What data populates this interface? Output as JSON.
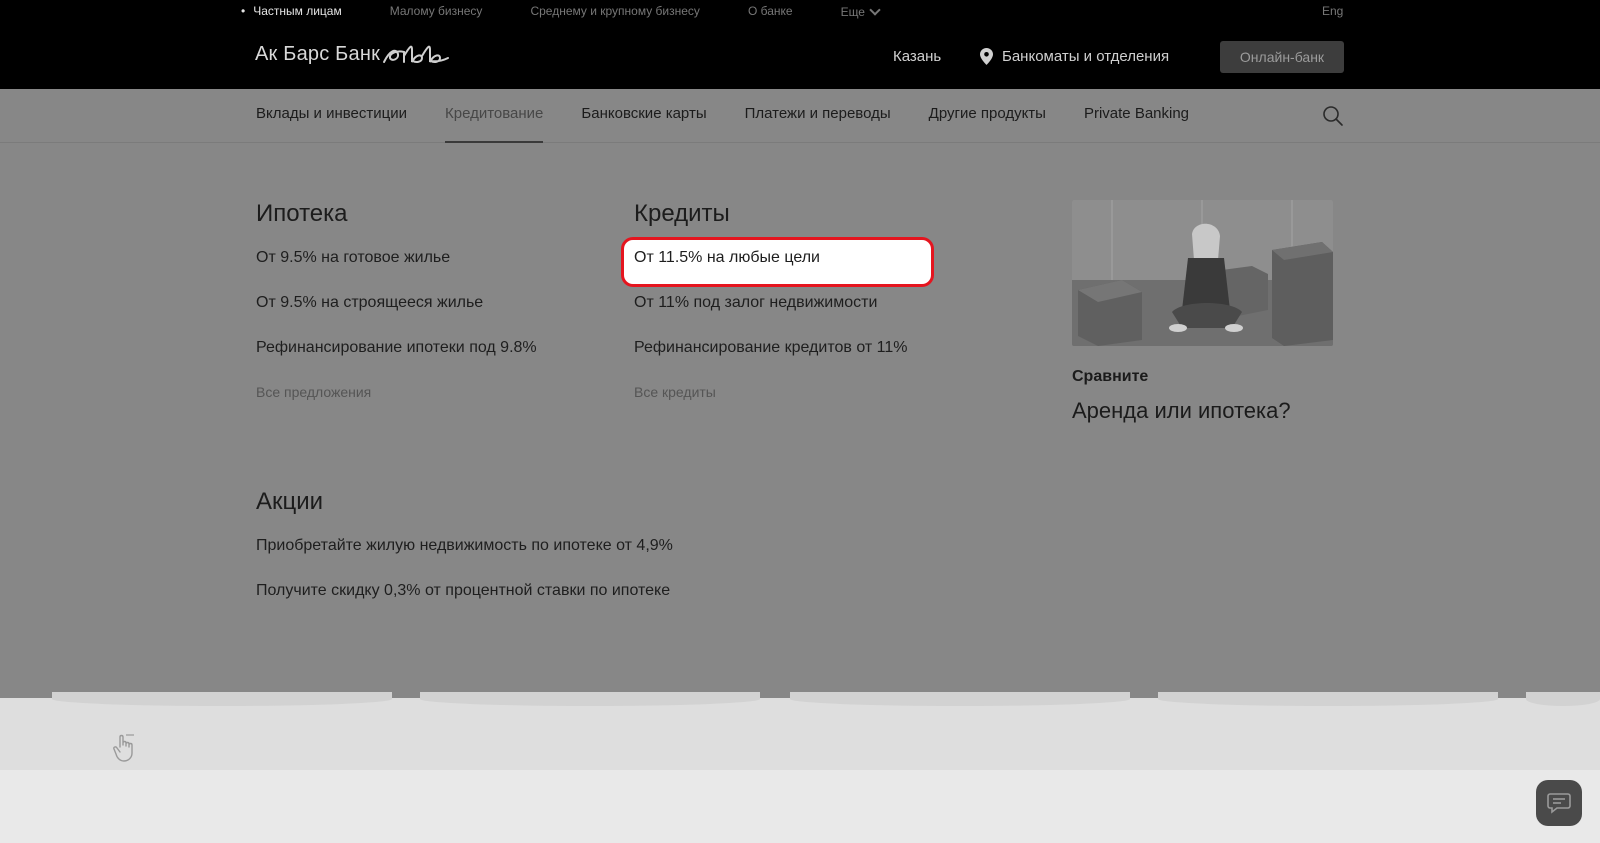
{
  "header": {
    "segments": [
      {
        "label": "Частным лицам",
        "active": true
      },
      {
        "label": "Малому бизнесу",
        "active": false
      },
      {
        "label": "Среднему и крупному бизнесу",
        "active": false
      },
      {
        "label": "О банке",
        "active": false
      }
    ],
    "more_label": "Еще",
    "lang_label": "Eng",
    "logo_text": "Ак Барс Банк",
    "city": "Казань",
    "atm_label": "Банкоматы и отделения",
    "online_bank_label": "Онлайн-банк"
  },
  "nav": {
    "items": [
      {
        "label": "Вклады и инвестиции",
        "active": false
      },
      {
        "label": "Кредитование",
        "active": true
      },
      {
        "label": "Банковские карты",
        "active": false
      },
      {
        "label": "Платежи и переводы",
        "active": false
      },
      {
        "label": "Другие продукты",
        "active": false
      },
      {
        "label": "Private Banking",
        "active": false
      }
    ],
    "search_icon": "search-icon"
  },
  "menu": {
    "mortgage": {
      "title": "Ипотека",
      "links": [
        "От 9.5% на готовое жилье",
        "От 9.5% на строящееся жилье",
        "Рефинансирование ипотеки под 9.8%"
      ],
      "all_label": "Все предложения"
    },
    "credits": {
      "title": "Кредиты",
      "links": [
        "От 11.5% на любые цели",
        "От 11% под залог недвижимости",
        "Рефинансирование кредитов от 11%"
      ],
      "all_label": "Все кредиты",
      "highlighted_index": 0
    },
    "promos": {
      "title": "Акции",
      "links": [
        "Приобретайте жилую недвижимость по ипотеке от 4,9%",
        "Получите скидку 0,3% от процентной ставки по ипотеке"
      ]
    },
    "feature": {
      "label": "Сравните",
      "title": "Аренда или ипотека?"
    }
  },
  "colors": {
    "highlight_border": "#e5151f",
    "topbar_bg": "#000000",
    "overlay_bg": "#878787"
  },
  "icons": [
    "location-pin-icon",
    "search-icon",
    "chevron-down-icon",
    "chat-icon",
    "hand-pointer-icon"
  ]
}
